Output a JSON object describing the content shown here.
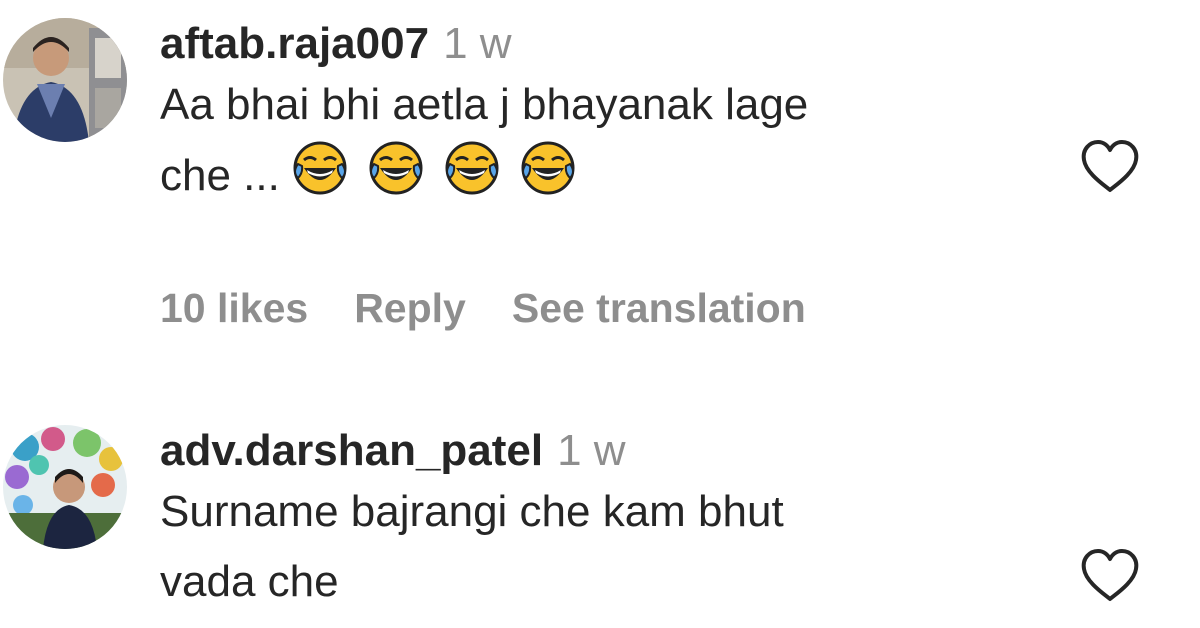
{
  "comments": [
    {
      "username": "aftab.raja007",
      "time": "1 w",
      "text_line1": "Aa bhai bhi aetla j bhayanak lage",
      "text_line2": "che ...",
      "emoji": [
        "face-with-tears-of-joy",
        "face-with-tears-of-joy",
        "face-with-tears-of-joy",
        "face-with-tears-of-joy"
      ],
      "likes": "10 likes",
      "reply_label": "Reply",
      "translate_label": "See translation",
      "like_icon": "heart-outline-icon"
    },
    {
      "username": "adv.darshan_patel",
      "time": "1 w",
      "text_line1": "Surname bajrangi che kam bhut",
      "text_line2": "vada che",
      "like_icon": "heart-outline-icon"
    }
  ],
  "colors": {
    "text": "#262626",
    "secondary": "#8e8e8e",
    "background": "#ffffff"
  }
}
